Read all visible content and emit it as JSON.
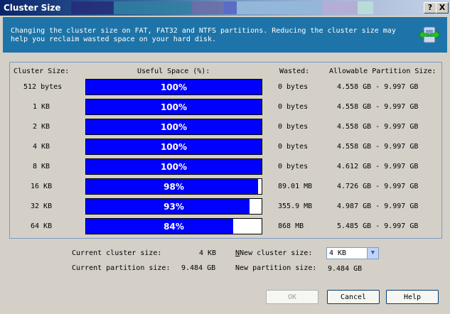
{
  "window": {
    "title": "Cluster Size",
    "help_btn": "?",
    "close_btn": "X"
  },
  "header": {
    "description": "Changing the cluster size on FAT, FAT32 and NTFS partitions. Reducing the cluster size may help you reclaim wasted space on your hard disk.",
    "icon": "partition-resize-icon"
  },
  "table": {
    "headers": {
      "cluster_size": "Cluster Size:",
      "useful_space": "Useful Space (%):",
      "wasted": "Wasted:",
      "allowable": "Allowable Partition Size:"
    },
    "rows": [
      {
        "size": "512 bytes",
        "useful_pct": 100,
        "useful_label": "100%",
        "wasted": "0 bytes",
        "allowable": "4.558 GB - 9.997 GB"
      },
      {
        "size": "1 KB",
        "useful_pct": 100,
        "useful_label": "100%",
        "wasted": "0 bytes",
        "allowable": "4.558 GB - 9.997 GB"
      },
      {
        "size": "2 KB",
        "useful_pct": 100,
        "useful_label": "100%",
        "wasted": "0 bytes",
        "allowable": "4.558 GB - 9.997 GB"
      },
      {
        "size": "4 KB",
        "useful_pct": 100,
        "useful_label": "100%",
        "wasted": "0 bytes",
        "allowable": "4.558 GB - 9.997 GB"
      },
      {
        "size": "8 KB",
        "useful_pct": 100,
        "useful_label": "100%",
        "wasted": "0 bytes",
        "allowable": "4.612 GB - 9.997 GB"
      },
      {
        "size": "16 KB",
        "useful_pct": 98,
        "useful_label": "98%",
        "wasted": "89.01 MB",
        "allowable": "4.726 GB - 9.997 GB"
      },
      {
        "size": "32 KB",
        "useful_pct": 93,
        "useful_label": "93%",
        "wasted": "355.9 MB",
        "allowable": "4.987 GB - 9.997 GB"
      },
      {
        "size": "64 KB",
        "useful_pct": 84,
        "useful_label": "84%",
        "wasted": "868 MB",
        "allowable": "5.485 GB - 9.997 GB"
      }
    ]
  },
  "info": {
    "current_cluster_label": "Current cluster size:",
    "current_cluster_value": "4 KB",
    "current_partition_label": "Current partition size:",
    "current_partition_value": "9.484 GB",
    "new_cluster_label": "New cluster size:",
    "new_cluster_value": "4 KB",
    "new_partition_label": "New partition size:",
    "new_partition_value": "9.484 GB"
  },
  "buttons": {
    "ok": "OK",
    "cancel": "Cancel",
    "help": "Help"
  },
  "colors": {
    "bar_fill": "#0000ff",
    "header_bg": "#1e74a8",
    "title_bar": "#0a246a"
  }
}
